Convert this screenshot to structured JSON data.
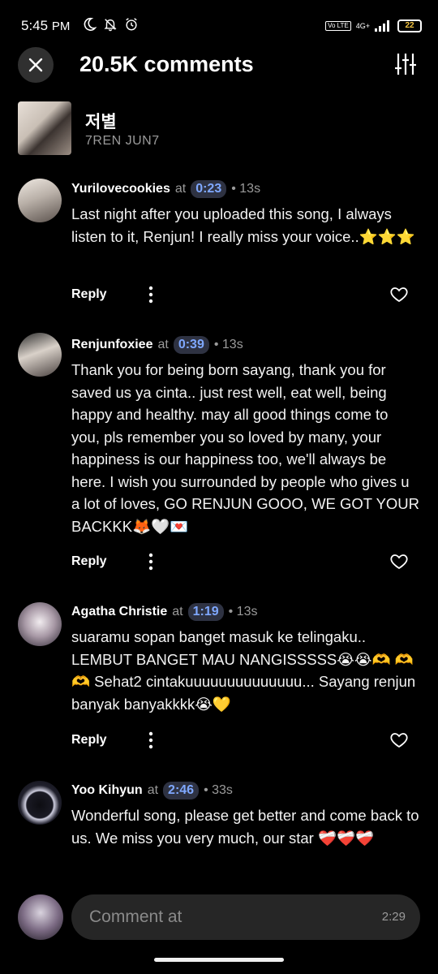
{
  "status_bar": {
    "time": "5:45",
    "ampm": "PM",
    "net_label": "4G+",
    "volte": "Vo LTE",
    "battery": "22"
  },
  "header": {
    "title": "20.5K comments"
  },
  "track": {
    "title": "저별",
    "artist": "7REN JUN7"
  },
  "comments": [
    {
      "user": "Yurilovecookies",
      "at": "at",
      "timestamp": "0:23",
      "age": "• 13s",
      "text": "Last night after you uploaded this song, I always listen to it, Renjun! I really miss your voice..⭐⭐⭐",
      "reply": "Reply"
    },
    {
      "user": "Renjunfoxiee",
      "at": "at",
      "timestamp": "0:39",
      "age": "• 13s",
      "text": "Thank you for being born sayang, thank you for saved us ya cinta.. just rest well, eat well, being happy and healthy. may all good things come to you, pls remember you so loved by many, your happiness is our happiness too, we'll always be here. I wish you surrounded by people who gives u a lot of loves, GO RENJUN GOOO, WE GOT YOUR BACKKK🦊🤍💌",
      "reply": "Reply"
    },
    {
      "user": "Agatha Christie",
      "at": "at",
      "timestamp": "1:19",
      "age": "• 13s",
      "text": "suaramu sopan banget masuk ke telingaku.. LEMBUT BANGET MAU NANGISSSSS😭😭🫶 🫶🫶 Sehat2 cintakuuuuuuuuuuuuuu... Sayang renjun banyak banyakkkk😭💛",
      "reply": "Reply"
    },
    {
      "user": "Yoo Kihyun",
      "at": "at",
      "timestamp": "2:46",
      "age": "• 33s",
      "text": "Wonderful song, please get better and come back to us. We miss you very much, our star ❤️‍🩹❤️‍🩹❤️‍🩹",
      "reply": "Reply"
    }
  ],
  "composer": {
    "placeholder": "Comment at",
    "time": "2:29"
  }
}
